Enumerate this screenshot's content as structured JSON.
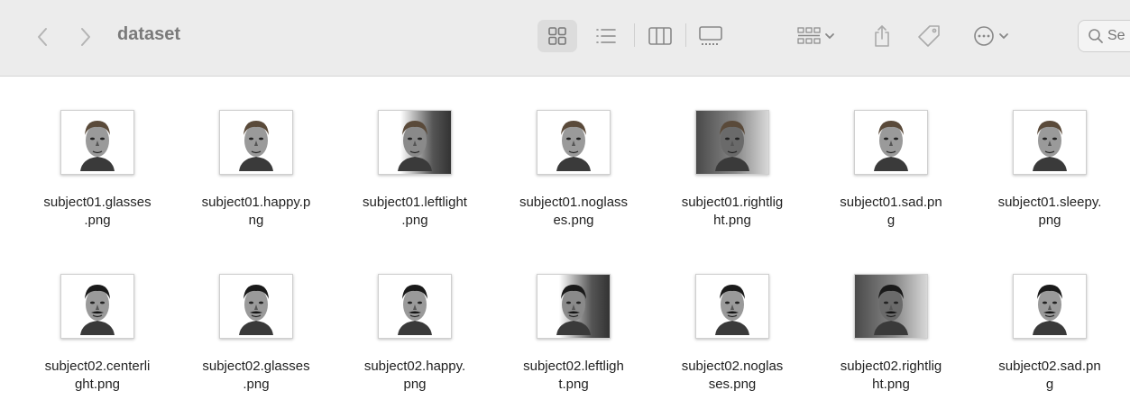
{
  "window": {
    "title": "dataset",
    "search_placeholder": "Se"
  },
  "toolbar": {
    "icons": [
      "back-icon",
      "forward-icon",
      "icon-view-icon",
      "list-view-icon",
      "column-view-icon",
      "gallery-view-icon",
      "group-icon",
      "share-icon",
      "tag-icon",
      "more-icon",
      "search-icon"
    ]
  },
  "files": [
    {
      "name": "subject01.glasses\n.png",
      "lighting": "center",
      "subject": 1
    },
    {
      "name": "subject01.happy.p\nng",
      "lighting": "center",
      "subject": 1
    },
    {
      "name": "subject01.leftlight\n.png",
      "lighting": "left",
      "subject": 1
    },
    {
      "name": "subject01.noglass\nes.png",
      "lighting": "center",
      "subject": 1
    },
    {
      "name": "subject01.rightlig\nht.png",
      "lighting": "right",
      "subject": 1
    },
    {
      "name": "subject01.sad.pn\ng",
      "lighting": "center",
      "subject": 1
    },
    {
      "name": "subject01.sleepy.\npng",
      "lighting": "center",
      "subject": 1
    },
    {
      "name": "subject02.centerli\nght.png",
      "lighting": "center",
      "subject": 2
    },
    {
      "name": "subject02.glasses\n.png",
      "lighting": "center",
      "subject": 2
    },
    {
      "name": "subject02.happy.\npng",
      "lighting": "center",
      "subject": 2
    },
    {
      "name": "subject02.leftligh\nt.png",
      "lighting": "left",
      "subject": 2
    },
    {
      "name": "subject02.noglas\nses.png",
      "lighting": "center",
      "subject": 2
    },
    {
      "name": "subject02.rightlig\nht.png",
      "lighting": "right",
      "subject": 2
    },
    {
      "name": "subject02.sad.pn\ng",
      "lighting": "center",
      "subject": 2
    }
  ]
}
